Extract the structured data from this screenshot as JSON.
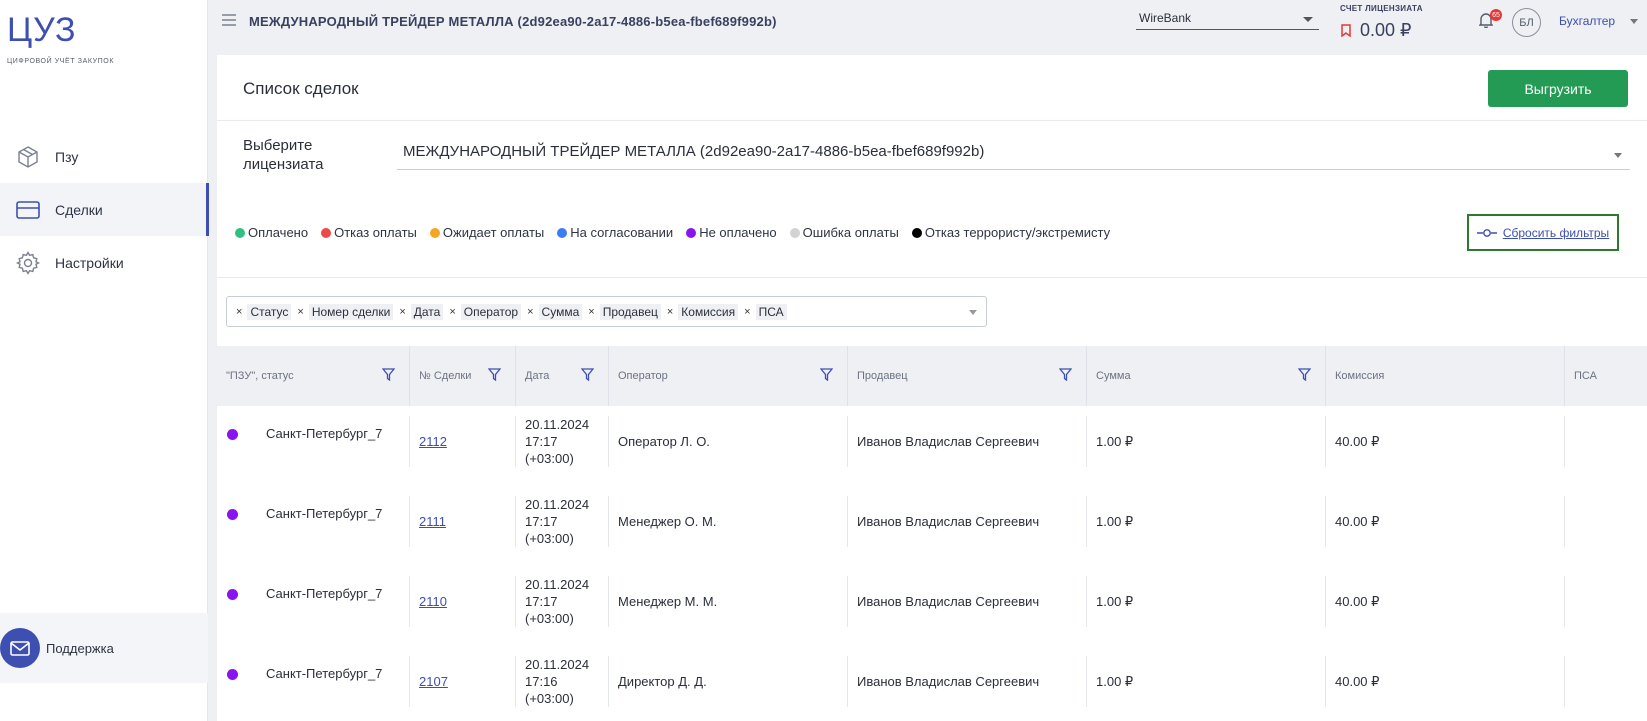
{
  "sidebar": {
    "logo_title": "ЦУЗ",
    "logo_subtitle": "ЦИФРОВОЙ УЧЁТ ЗАКУПОК",
    "items": [
      {
        "label": "Пзу",
        "icon": "cube-icon"
      },
      {
        "label": "Сделки",
        "icon": "card-icon",
        "active": true
      },
      {
        "label": "Настройки",
        "icon": "gear-icon"
      }
    ],
    "support_label": "Поддержка"
  },
  "topbar": {
    "title": "МЕЖДУНАРОДНЫЙ ТРЕЙДЕР МЕТАЛЛА (2d92ea90-2a17-4886-b5ea-fbef689f992b)",
    "bank": "WireBank",
    "balance_label": "СЧЕТ ЛИЦЕНЗИАТА",
    "balance_value": "0.00 ₽",
    "notifications_count": "65",
    "avatar_initials": "БЛ",
    "role": "Бухгалтер"
  },
  "panel": {
    "title": "Список сделок",
    "export_label": "Выгрузить",
    "licensee_label": "Выберите лицензиата",
    "licensee_value": "МЕЖДУНАРОДНЫЙ ТРЕЙДЕР МЕТАЛЛА (2d92ea90-2a17-4886-b5ea-fbef689f992b)",
    "reset_label": "Сбросить фильтры",
    "legend": [
      {
        "label": "Оплачено",
        "color": "#2ec27e"
      },
      {
        "label": "Отказ оплаты",
        "color": "#f04848"
      },
      {
        "label": "Ожидает оплаты",
        "color": "#f5a623"
      },
      {
        "label": "На согласовании",
        "color": "#3b7df0"
      },
      {
        "label": "Не оплачено",
        "color": "#8a14f0"
      },
      {
        "label": "Ошибка оплаты",
        "color": "#d3d3d3"
      },
      {
        "label": "Отказ террористу/экстремисту",
        "color": "#000000"
      }
    ],
    "columns": [
      "Статус",
      "Номер сделки",
      "Дата",
      "Оператор",
      "Сумма",
      "Продавец",
      "Комиссия",
      "ПСА"
    ]
  },
  "table": {
    "headers": [
      "\"ПЗУ\", статус",
      "№ Сделки",
      "Дата",
      "Оператор",
      "Продавец",
      "Сумма",
      "Комиссия",
      "ПСА"
    ],
    "rows": [
      {
        "pzu": "Санкт-Петербург_7",
        "deal": "2112",
        "date": "20.11.2024",
        "time": "17:17",
        "tz": "(+03:00)",
        "operator": "Оператор Л. О.",
        "seller": "Иванов Владислав Сергеевич",
        "sum": "1.00 ₽",
        "commission": "40.00 ₽",
        "psa": ""
      },
      {
        "pzu": "Санкт-Петербург_7",
        "deal": "2111",
        "date": "20.11.2024",
        "time": "17:17",
        "tz": "(+03:00)",
        "operator": "Менеджер О. М.",
        "seller": "Иванов Владислав Сергеевич",
        "sum": "1.00 ₽",
        "commission": "40.00 ₽",
        "psa": ""
      },
      {
        "pzu": "Санкт-Петербург_7",
        "deal": "2110",
        "date": "20.11.2024",
        "time": "17:17",
        "tz": "(+03:00)",
        "operator": "Менеджер М. М.",
        "seller": "Иванов Владислав Сергеевич",
        "sum": "1.00 ₽",
        "commission": "40.00 ₽",
        "psa": ""
      },
      {
        "pzu": "Санкт-Петербург_7",
        "deal": "2107",
        "date": "20.11.2024",
        "time": "17:16",
        "tz": "(+03:00)",
        "operator": "Директор Д. Д.",
        "seller": "Иванов Владислав Сергеевич",
        "sum": "1.00 ₽",
        "commission": "40.00 ₽",
        "psa": ""
      }
    ]
  }
}
